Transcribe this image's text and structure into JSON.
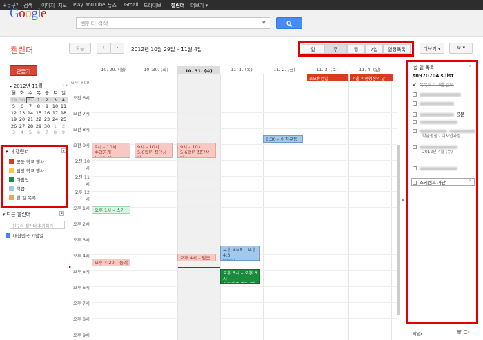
{
  "topbar": {
    "items": [
      "+누구?",
      "검색",
      "이미지",
      "지도",
      "Play",
      "YouTube",
      "뉴스",
      "Gmail",
      "드라이브",
      "캘린더",
      "더보기 ▾"
    ],
    "active_index": 9
  },
  "header": {
    "logo": "Google",
    "logo_colors": [
      "#3369e8",
      "#d50f25",
      "#eeb211",
      "#3369e8",
      "#009925",
      "#d50f25"
    ],
    "search_placeholder": "캘린더 검색",
    "search_button_icon": "search-icon"
  },
  "toolbar": {
    "app_name": "캘린더",
    "today_label": "오늘",
    "prev_label": "‹",
    "next_label": "›",
    "date_range": "2012년 10월 29일 – 11월 4일",
    "view_tabs": [
      "일",
      "주",
      "월",
      "7일",
      "일정목록"
    ],
    "selected_view": "주",
    "more_label": "더보기 ▾",
    "settings_label": "⚙ ▾"
  },
  "sidebar": {
    "create_label": "만들기",
    "mini_calendar": {
      "title": "▸ 2012년 11월",
      "nav": "‹ ›",
      "weekdays": [
        "월",
        "화",
        "수",
        "목",
        "금",
        "토",
        "일"
      ],
      "rows": [
        [
          "29",
          "30",
          "31",
          "1",
          "2",
          "3",
          "4"
        ],
        [
          "5",
          "6",
          "7",
          "8",
          "9",
          "10",
          "11"
        ],
        [
          "12",
          "13",
          "14",
          "15",
          "16",
          "17",
          "18"
        ],
        [
          "19",
          "20",
          "21",
          "22",
          "23",
          "24",
          "25"
        ],
        [
          "26",
          "27",
          "28",
          "29",
          "30",
          "1",
          "2"
        ],
        [
          "3",
          "4",
          "5",
          "6",
          "7",
          "8",
          "9"
        ]
      ],
      "today": "31"
    },
    "my_calendars": {
      "title": "▾ 내 캘린더",
      "items": [
        {
          "label": "공동 학교 행사",
          "color": "#d93b1f"
        },
        {
          "label": "담당 학교 행사",
          "color": "#f2c94c"
        },
        {
          "label": "아람단",
          "color": "#1b8c3e"
        },
        {
          "label": "학급",
          "color": "#9fc6e7"
        },
        {
          "label": "할 일 목록",
          "color": "#f4a259"
        }
      ]
    },
    "other_calendars": {
      "title": "▾ 다른 캘린더",
      "add_placeholder": "친구의 캘린더 추가하기",
      "items": [
        {
          "label": "대한민국 기념일",
          "color": "#4a86e8"
        }
      ]
    }
  },
  "week": {
    "timezone": "GMT+09",
    "days": [
      "10. 29. (월)",
      "10. 30. (화)",
      "10. 31. (수)",
      "11. 1. (목)",
      "11. 2. (금)",
      "11. 3. (토)",
      "11. 4. (일)"
    ],
    "selected_day_index": 2,
    "hours": [
      "오전 6시",
      "오전 7시",
      "오전 8시",
      "오전 9시",
      "오전 10시",
      "오전 11시",
      "오후 12시",
      "오후 1시",
      "오후 2시",
      "오후 3시",
      "오후 4시",
      "오후 5시",
      "오후 6시",
      "오후 7시",
      "오후 8시",
      "오후 9시"
    ],
    "allday_events": [
      "토요휴업일",
      "서울 학생행정의 날"
    ],
    "events": [
      {
        "time": "9시 – 10시",
        "title": "수업공개(~11.2)"
      },
      {
        "time": "9시 – 10시",
        "title": "5,6학년 집단상담"
      },
      {
        "time": "9시 – 10시",
        "title": "5,6학년 집단상담"
      },
      {
        "time": "8:30 – 아침운동당번",
        "title": ""
      },
      {
        "time": "오후 1시 – 스키캠프",
        "title": ""
      },
      {
        "time": "오후 3:30 – 오후 4:3",
        "title": "어머니"
      },
      {
        "time": "오후 4:20 – 동례",
        "title": ""
      },
      {
        "time": "오후 4시 – 맞춤형 학",
        "title": ""
      },
      {
        "time": "오후 5시 – 오후 6시",
        "title": "스키캠프 명단 제출"
      }
    ]
  },
  "tasks": {
    "title": "할 일 목록",
    "list_name": "sn970704's list",
    "items": [
      {
        "text": "목목프로그램 준비",
        "done": true
      },
      {
        "text": "",
        "done": false
      },
      {
        "text": "",
        "done": false
      },
      {
        "text": "공문",
        "done": false
      },
      {
        "text": "",
        "done": false
      },
      {
        "text": "",
        "done": false
      },
      {
        "text": "",
        "done": false
      },
      {
        "text": "",
        "done": false
      },
      {
        "text": "스키캠프 가안",
        "done": false
      }
    ],
    "subnote_1": "학급평점 - 디자인과정...",
    "subnote_2": "2012년 4월 (수)",
    "footer_label": "작업▸",
    "footer_icons": "+ 🗑 ☰▾"
  }
}
